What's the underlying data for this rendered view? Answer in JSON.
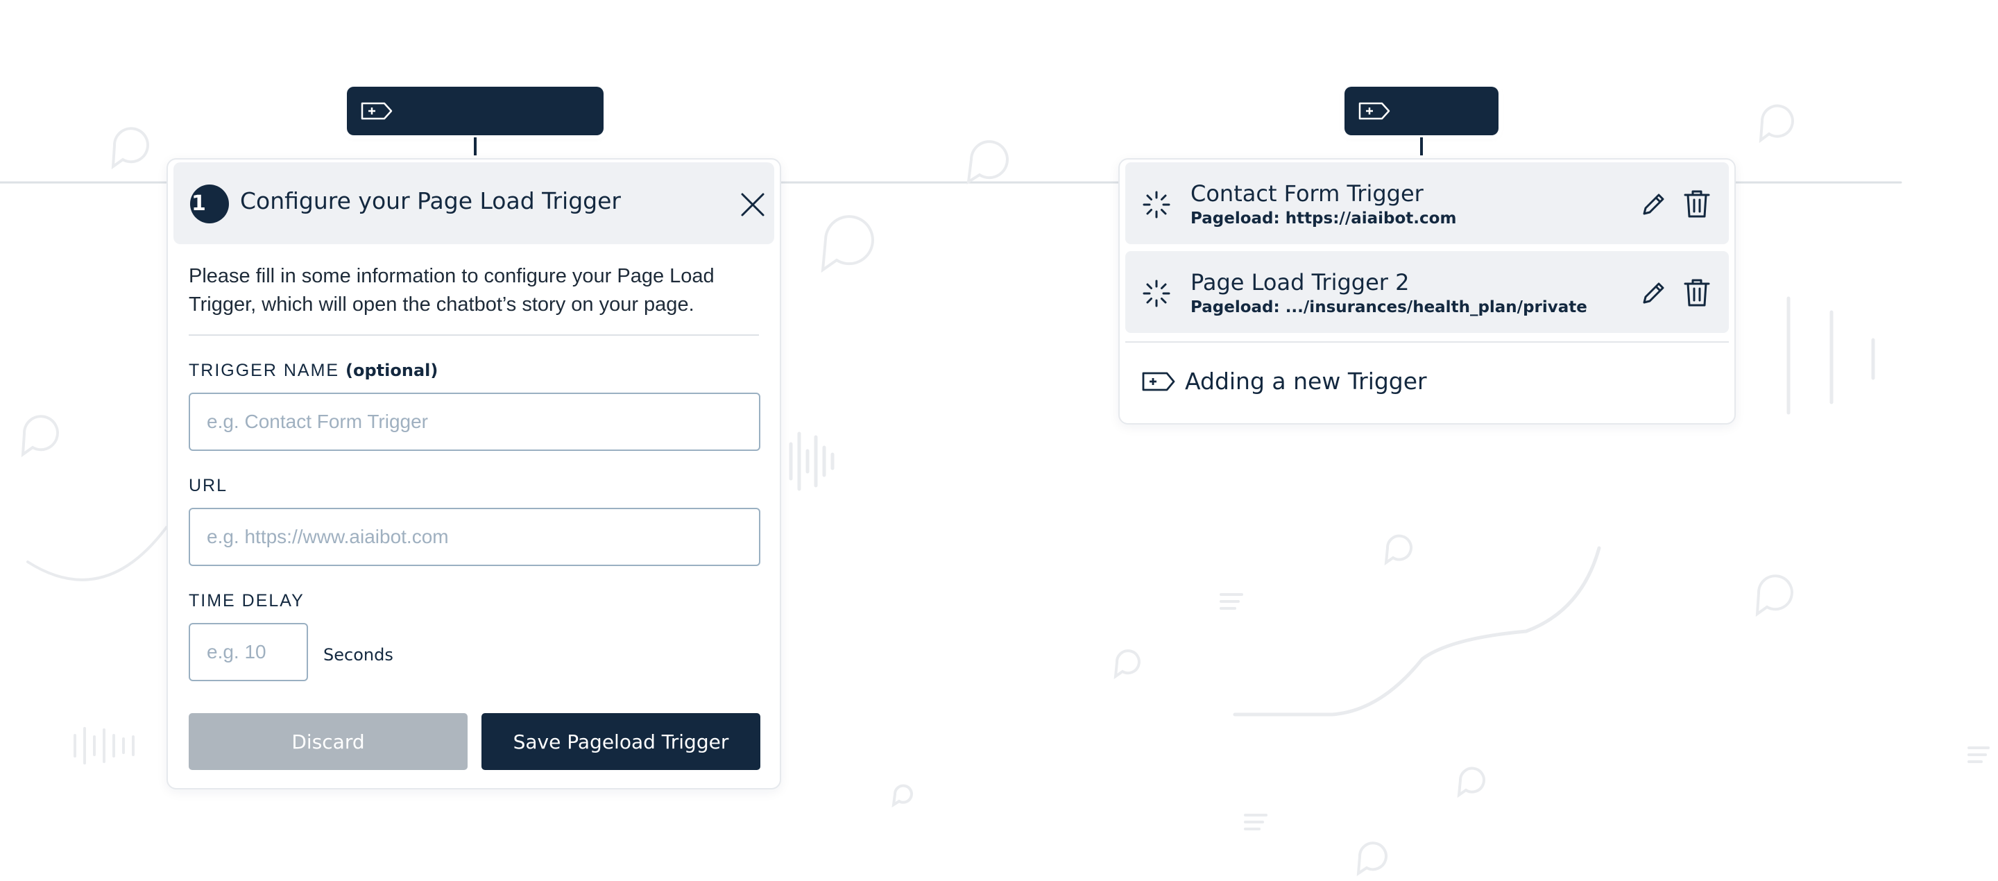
{
  "config_panel": {
    "step_number": "1",
    "title": "Configure your Page Load Trigger",
    "description": "Please fill in some information to configure your Page Load Trigger, which will open the chatbot’s story on your page.",
    "fields": {
      "trigger_name": {
        "label": "TRIGGER NAME",
        "optional_label": "(optional)",
        "value": "",
        "placeholder": "e.g. Contact Form Trigger"
      },
      "url": {
        "label": "URL",
        "value": "",
        "placeholder": "e.g. https://www.aiaibot.com"
      },
      "time_delay": {
        "label": "TIME DELAY",
        "value": "",
        "placeholder": "e.g. 10",
        "unit": "Seconds"
      }
    },
    "buttons": {
      "discard": "Discard",
      "save": "Save Pageload Trigger"
    }
  },
  "trigger_list": {
    "items": [
      {
        "name": "Contact Form Trigger",
        "detail": "Pageload: https://aiaibot.com"
      },
      {
        "name": "Page Load Trigger 2",
        "detail": "Pageload: .../insurances/health_plan/private"
      }
    ],
    "add_label": "Adding a new Trigger"
  },
  "icons": {
    "trigger_pill": "add-trigger-tag-icon",
    "close": "close-icon",
    "status": "loading-spinner-icon",
    "edit": "pencil-icon",
    "delete": "trash-icon",
    "add": "add-trigger-tag-icon"
  },
  "colors": {
    "primary": "#13283f",
    "panel_header_bg": "#eff1f4",
    "discard_button": "#aeb6be",
    "input_border": "#9ab0c2",
    "placeholder": "#9fb0c0"
  }
}
